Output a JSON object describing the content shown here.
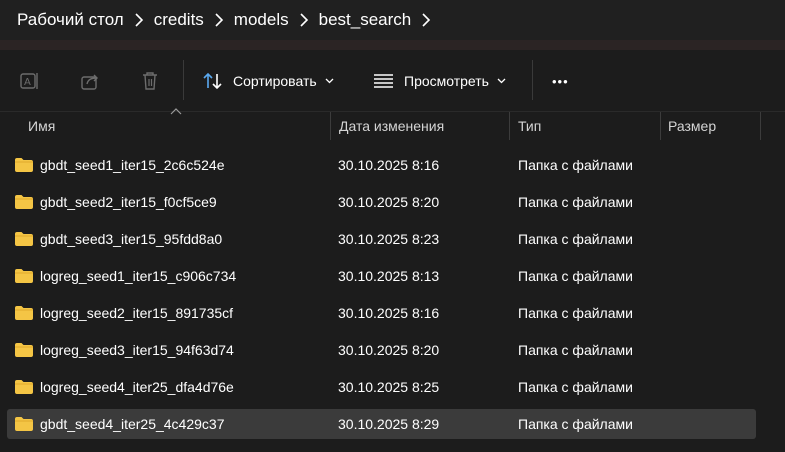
{
  "breadcrumb": [
    "Рабочий стол",
    "credits",
    "models",
    "best_search"
  ],
  "toolbar": {
    "sort_label": "Сортировать",
    "view_label": "Просмотреть",
    "more_label": "•••"
  },
  "columns": {
    "name": "Имя",
    "date": "Дата изменения",
    "type": "Тип",
    "size": "Размер"
  },
  "files": [
    {
      "name": "gbdt_seed1_iter15_2c6c524e",
      "date": "30.10.2025 8:16",
      "type": "Папка с файлами",
      "size": ""
    },
    {
      "name": "gbdt_seed2_iter15_f0cf5ce9",
      "date": "30.10.2025 8:20",
      "type": "Папка с файлами",
      "size": ""
    },
    {
      "name": "gbdt_seed3_iter15_95fdd8a0",
      "date": "30.10.2025 8:23",
      "type": "Папка с файлами",
      "size": ""
    },
    {
      "name": "logreg_seed1_iter15_c906c734",
      "date": "30.10.2025 8:13",
      "type": "Папка с файлами",
      "size": ""
    },
    {
      "name": "logreg_seed2_iter15_891735cf",
      "date": "30.10.2025 8:16",
      "type": "Папка с файлами",
      "size": ""
    },
    {
      "name": "logreg_seed3_iter15_94f63d74",
      "date": "30.10.2025 8:20",
      "type": "Папка с файлами",
      "size": ""
    },
    {
      "name": "logreg_seed4_iter25_dfa4d76e",
      "date": "30.10.2025 8:25",
      "type": "Папка с файлами",
      "size": ""
    },
    {
      "name": "gbdt_seed4_iter25_4c429c37",
      "date": "30.10.2025 8:29",
      "type": "Папка с файлами",
      "size": ""
    }
  ],
  "selected_index": 7,
  "colors": {
    "folder": "#f4c545",
    "background": "#1c1c1c",
    "selection": "#3b3b3b"
  }
}
